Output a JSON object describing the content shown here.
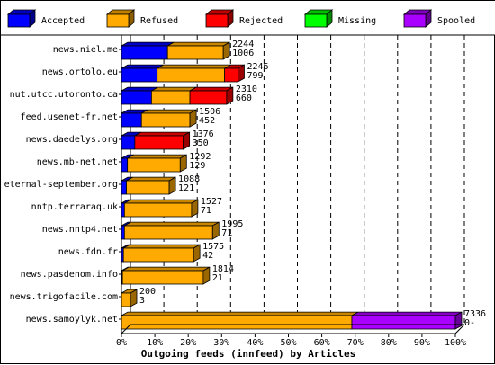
{
  "chart_data": {
    "type": "bar",
    "stacked": true,
    "orientation": "horizontal",
    "style": "3d",
    "xlabel": "Outgoing feeds (innfeed) by Articles",
    "xlim": [
      0,
      100
    ],
    "xunit": "%",
    "xticks": [
      "0%",
      "10%",
      "20%",
      "30%",
      "40%",
      "50%",
      "60%",
      "70%",
      "80%",
      "90%",
      "100%"
    ],
    "grid": "vertical dashed",
    "legend_position": "top",
    "legend": [
      {
        "name": "Accepted",
        "color": "#0000ff"
      },
      {
        "name": "Refused",
        "color": "#ffaa00"
      },
      {
        "name": "Rejected",
        "color": "#ff0000"
      },
      {
        "name": "Missing",
        "color": "#00ff00"
      },
      {
        "name": "Spooled",
        "color": "#aa00ff"
      }
    ],
    "categories": [
      "news.niel.me",
      "news.ortolo.eu",
      "nut.utcc.utoronto.ca",
      "feed.usenet-fr.net",
      "news.daedelys.org",
      "news.mb-net.net",
      "eternal-september.org",
      "nntp.terraraq.uk",
      "news.nntp4.net",
      "news.fdn.fr",
      "news.pasdenom.info",
      "news.trigofacile.com",
      "news.samoylyk.net"
    ],
    "totals": [
      2244,
      2246,
      2310,
      1506,
      1376,
      1292,
      1088,
      1527,
      1995,
      1575,
      1814,
      200,
      7336
    ],
    "accepted_labels": [
      "1006",
      "799",
      "660",
      "452",
      "350",
      "129",
      "121",
      "71",
      "71",
      "42",
      "21",
      "3",
      "0-"
    ],
    "series": [
      {
        "name": "Accepted",
        "values": [
          13.8,
          10.7,
          9.0,
          6.0,
          4.0,
          1.8,
          1.5,
          0.9,
          0.9,
          0.6,
          0.3,
          0.0,
          0.0
        ]
      },
      {
        "name": "Refused",
        "values": [
          16.7,
          20.2,
          11.5,
          14.5,
          0.0,
          15.8,
          12.8,
          20.1,
          26.4,
          21.0,
          24.2,
          2.7,
          69.0
        ]
      },
      {
        "name": "Rejected",
        "values": [
          0.0,
          4.0,
          11.0,
          0.0,
          14.5,
          0.0,
          0.0,
          0.0,
          0.0,
          0.0,
          0.0,
          0.0,
          0.0
        ]
      },
      {
        "name": "Missing",
        "values": [
          0.0,
          0.0,
          0.0,
          0.0,
          0.0,
          0.0,
          0.0,
          0.0,
          0.0,
          0.0,
          0.0,
          0.0,
          0.0
        ]
      },
      {
        "name": "Spooled",
        "values": [
          0.0,
          0.0,
          0.0,
          0.0,
          0.0,
          0.0,
          0.0,
          0.0,
          0.0,
          0.0,
          0.0,
          0.0,
          31.0
        ]
      }
    ]
  }
}
